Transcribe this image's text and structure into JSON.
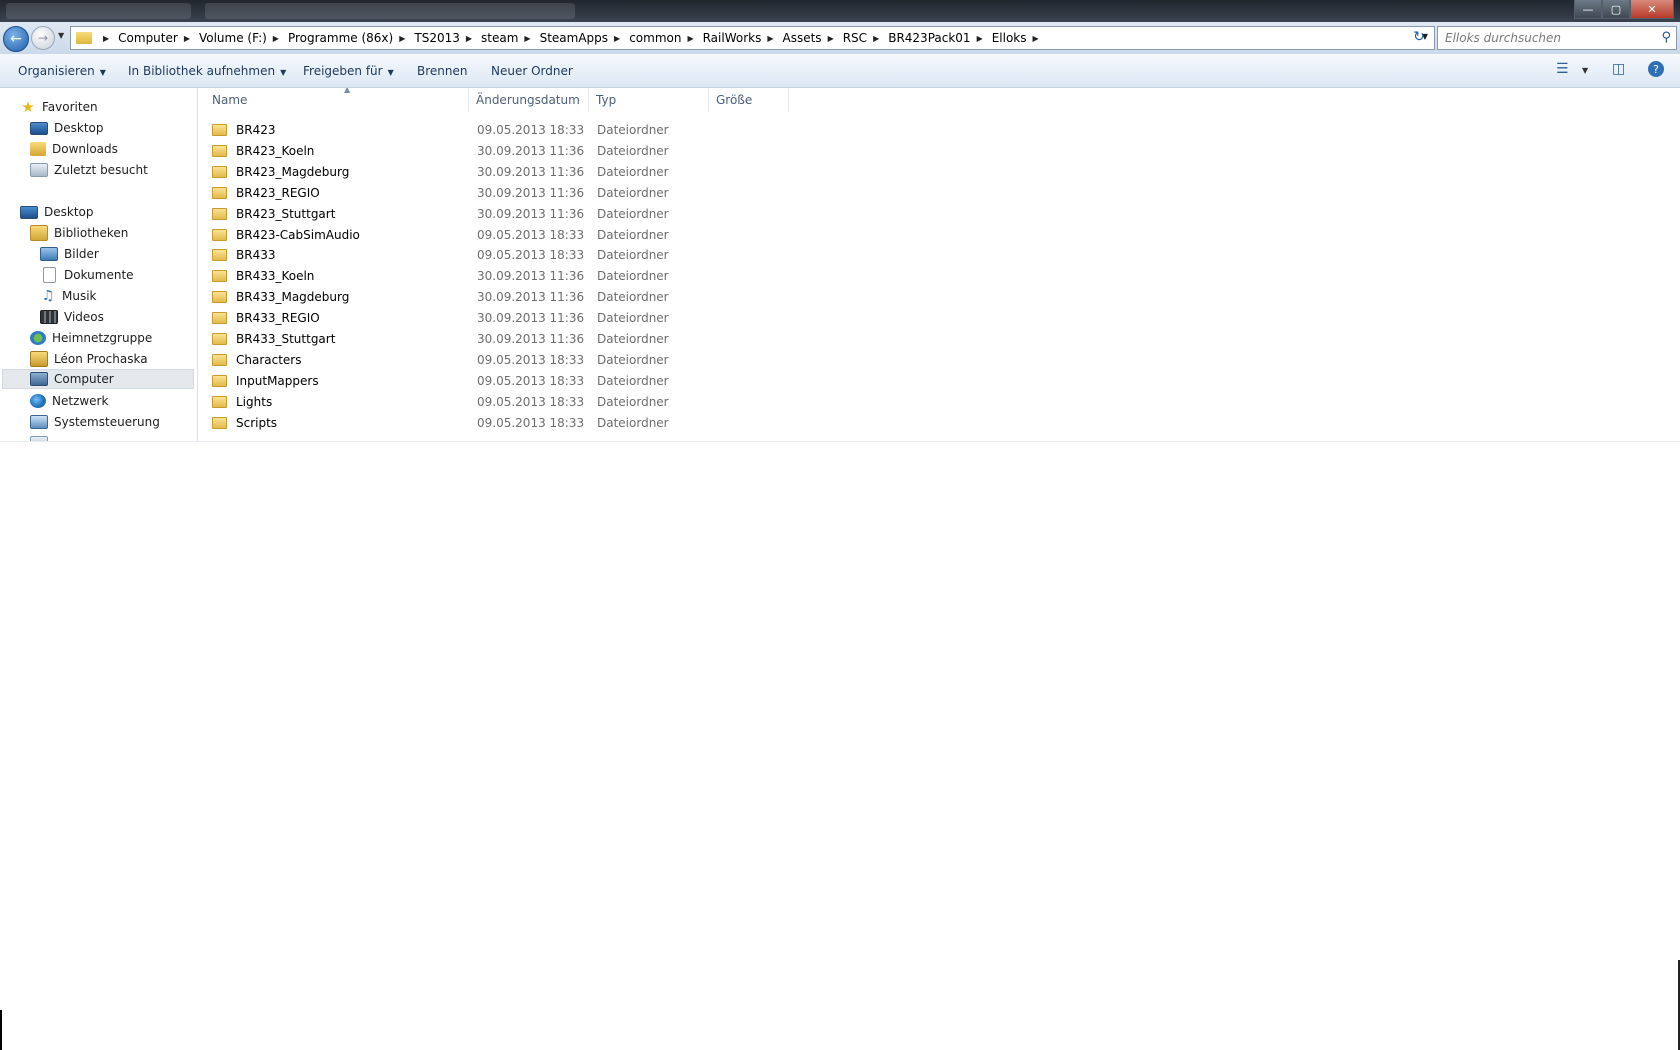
{
  "window": {
    "buttons": {
      "minimize": "—",
      "maximize": "▢",
      "close": "✕"
    }
  },
  "address": {
    "crumbs": [
      "Computer",
      "Volume (F:)",
      "Programme (86x)",
      "TS2013",
      "steam",
      "SteamApps",
      "common",
      "RailWorks",
      "Assets",
      "RSC",
      "BR423Pack01",
      "Elloks"
    ],
    "search_placeholder": "Elloks durchsuchen"
  },
  "toolbar": {
    "organize": "Organisieren",
    "library": "In Bibliothek aufnehmen",
    "share": "Freigeben für",
    "burn": "Brennen",
    "new_folder": "Neuer Ordner"
  },
  "nav": {
    "favorites": "Favoriten",
    "fav_items": [
      "Desktop",
      "Downloads",
      "Zuletzt besucht"
    ],
    "desktop": "Desktop",
    "libraries": "Bibliotheken",
    "lib_items": [
      "Bilder",
      "Dokumente",
      "Musik",
      "Videos"
    ],
    "homegroup": "Heimnetzgruppe",
    "user": "Léon Prochaska",
    "computer": "Computer",
    "network": "Netzwerk",
    "control": "Systemsteuerung"
  },
  "columns": {
    "name": "Name",
    "date": "Änderungsdatum",
    "type": "Typ",
    "size": "Größe"
  },
  "files": [
    {
      "name": "BR423",
      "date": "09.05.2013 18:33",
      "type": "Dateiordner"
    },
    {
      "name": "BR423_Koeln",
      "date": "30.09.2013 11:36",
      "type": "Dateiordner"
    },
    {
      "name": "BR423_Magdeburg",
      "date": "30.09.2013 11:36",
      "type": "Dateiordner"
    },
    {
      "name": "BR423_REGIO",
      "date": "30.09.2013 11:36",
      "type": "Dateiordner"
    },
    {
      "name": "BR423_Stuttgart",
      "date": "30.09.2013 11:36",
      "type": "Dateiordner"
    },
    {
      "name": "BR423-CabSimAudio",
      "date": "09.05.2013 18:33",
      "type": "Dateiordner"
    },
    {
      "name": "BR433",
      "date": "09.05.2013 18:33",
      "type": "Dateiordner"
    },
    {
      "name": "BR433_Koeln",
      "date": "30.09.2013 11:36",
      "type": "Dateiordner"
    },
    {
      "name": "BR433_Magdeburg",
      "date": "30.09.2013 11:36",
      "type": "Dateiordner"
    },
    {
      "name": "BR433_REGIO",
      "date": "30.09.2013 11:36",
      "type": "Dateiordner"
    },
    {
      "name": "BR433_Stuttgart",
      "date": "30.09.2013 11:36",
      "type": "Dateiordner"
    },
    {
      "name": "Characters",
      "date": "09.05.2013 18:33",
      "type": "Dateiordner"
    },
    {
      "name": "InputMappers",
      "date": "09.05.2013 18:33",
      "type": "Dateiordner"
    },
    {
      "name": "Lights",
      "date": "09.05.2013 18:33",
      "type": "Dateiordner"
    },
    {
      "name": "Scripts",
      "date": "09.05.2013 18:33",
      "type": "Dateiordner"
    }
  ]
}
